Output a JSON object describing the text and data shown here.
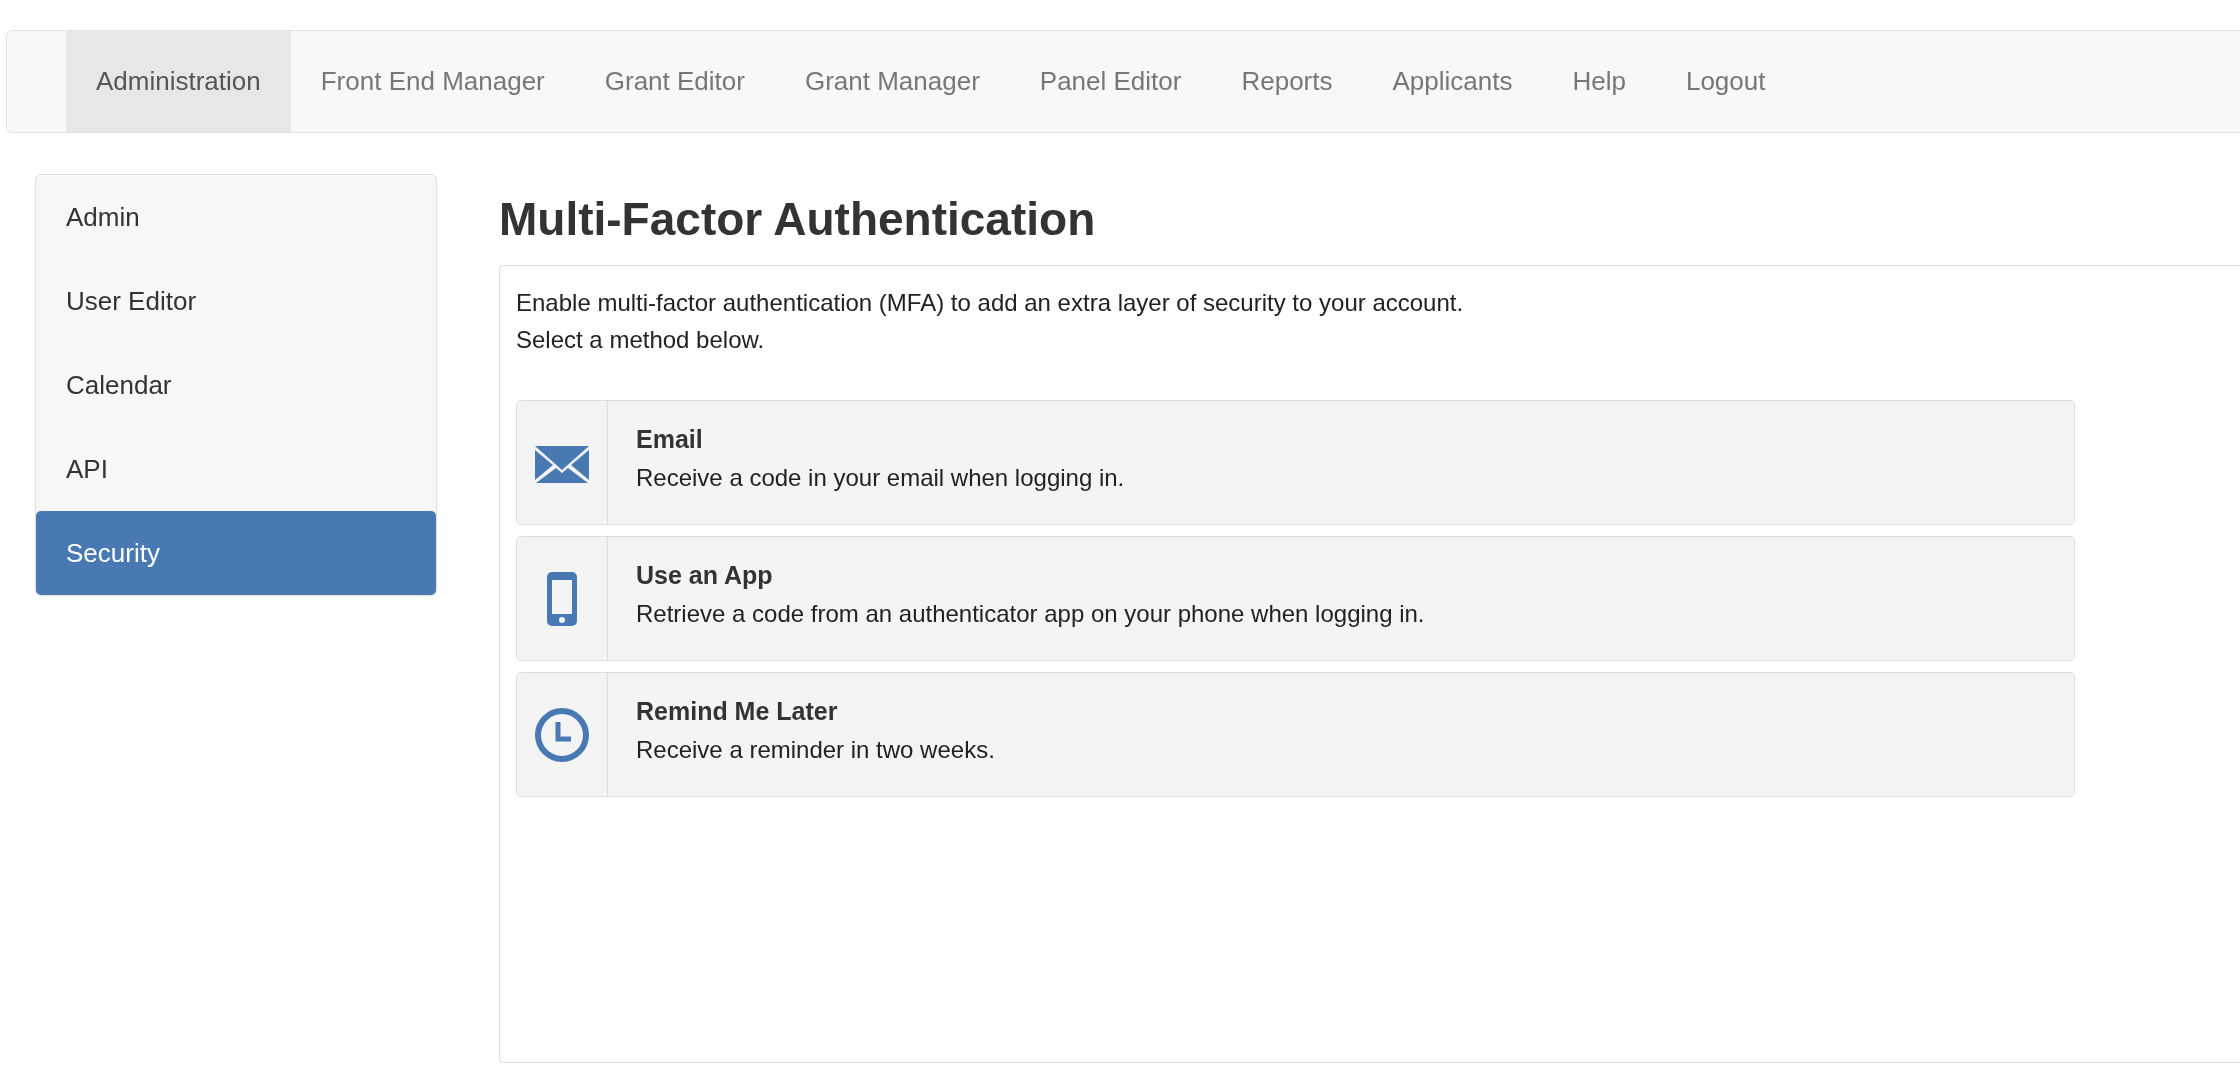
{
  "navbar": {
    "items": [
      {
        "label": "Administration",
        "selected": true
      },
      {
        "label": "Front End Manager",
        "selected": false
      },
      {
        "label": "Grant Editor",
        "selected": false
      },
      {
        "label": "Grant Manager",
        "selected": false
      },
      {
        "label": "Panel Editor",
        "selected": false
      },
      {
        "label": "Reports",
        "selected": false
      },
      {
        "label": "Applicants",
        "selected": false
      },
      {
        "label": "Help",
        "selected": false
      },
      {
        "label": "Logout",
        "selected": false
      }
    ]
  },
  "sidebar": {
    "items": [
      {
        "label": "Admin",
        "selected": false
      },
      {
        "label": "User Editor",
        "selected": false
      },
      {
        "label": "Calendar",
        "selected": false
      },
      {
        "label": "API",
        "selected": false
      },
      {
        "label": "Security",
        "selected": true
      }
    ]
  },
  "main": {
    "title": "Multi-Factor Authentication",
    "intro": [
      "Enable multi-factor authentication (MFA) to add an extra layer of security to your account.",
      "Select a method below."
    ],
    "methods": [
      {
        "kind": "email",
        "title": "Email",
        "description": "Receive a code in your email when logging in."
      },
      {
        "kind": "app",
        "title": "Use an App",
        "description": "Retrieve a code from an authenticator app on your phone when logging in."
      },
      {
        "kind": "remind",
        "title": "Remind Me Later",
        "description": "Receive a reminder in two weeks."
      }
    ]
  }
}
